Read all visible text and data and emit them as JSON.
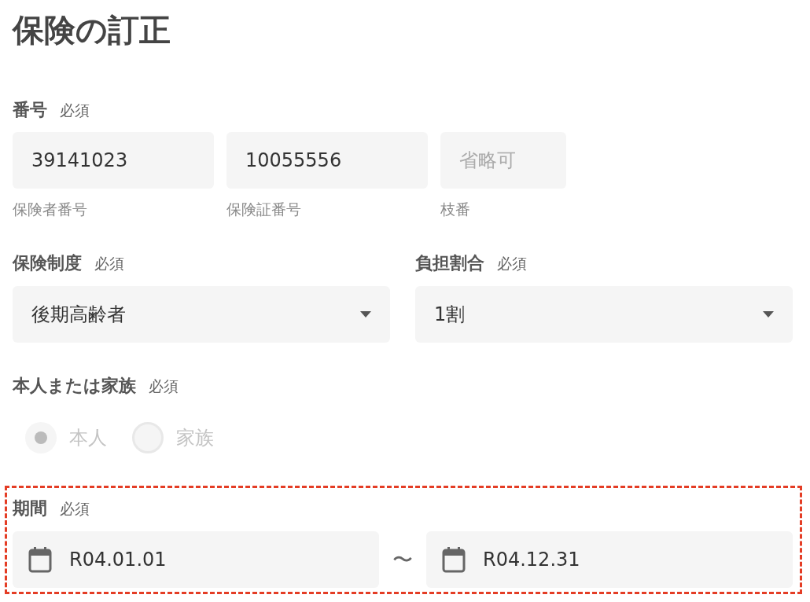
{
  "title": "保険の訂正",
  "number": {
    "label": "番号",
    "required": "必須",
    "fields": [
      {
        "value": "39141023",
        "caption": "保険者番号"
      },
      {
        "value": "10055556",
        "caption": "保険証番号"
      },
      {
        "placeholder": "省略可",
        "caption": "枝番"
      }
    ]
  },
  "selects": [
    {
      "label": "保険制度",
      "required": "必須",
      "value": "後期高齢者"
    },
    {
      "label": "負担割合",
      "required": "必須",
      "value": "1割"
    }
  ],
  "relation": {
    "label": "本人または家族",
    "required": "必須",
    "disabled": true,
    "options": [
      {
        "label": "本人",
        "selected": true
      },
      {
        "label": "家族",
        "selected": false
      }
    ]
  },
  "period": {
    "label": "期間",
    "required": "必須",
    "highlighted": true,
    "from": "R04.01.01",
    "separator": "〜",
    "to": "R04.12.31"
  }
}
